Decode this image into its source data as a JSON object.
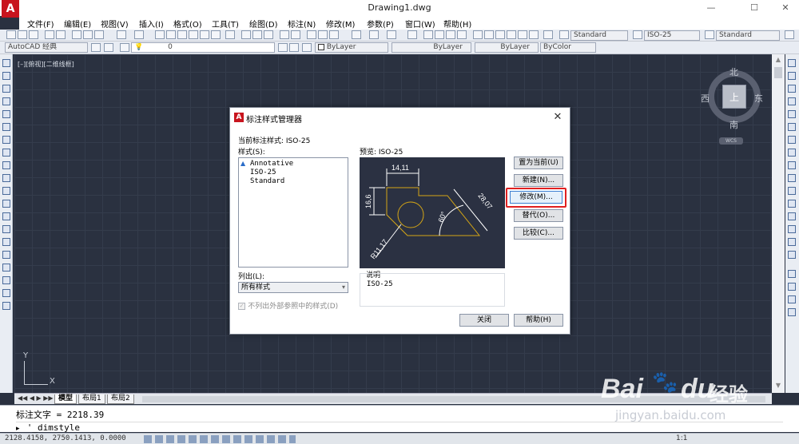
{
  "window": {
    "title": "Drawing1.dwg",
    "logo_letter": "A",
    "controls": [
      "—",
      "☐",
      "✕"
    ]
  },
  "menu": [
    "文件(F)",
    "编辑(E)",
    "视图(V)",
    "插入(I)",
    "格式(O)",
    "工具(T)",
    "绘图(D)",
    "标注(N)",
    "修改(M)",
    "参数(P)",
    "窗口(W)",
    "帮助(H)"
  ],
  "toolbar1": {
    "text_style": "Standard",
    "dim_style": "ISO-25",
    "table_style": "Standard"
  },
  "toolbar2": {
    "workspace": "AutoCAD 经典",
    "layer": "0",
    "color": "ByLayer",
    "linetype": "ByLayer",
    "lineweight": "ByLayer",
    "plotstyle": "ByColor"
  },
  "canvas": {
    "view_label": "[–][俯视][二维线框]"
  },
  "viewcube": {
    "north": "北",
    "south": "南",
    "east": "东",
    "west": "西",
    "face": "上",
    "wcs": "WCS"
  },
  "ucs": {
    "y": "Y",
    "x": "X"
  },
  "tabs": [
    "模型",
    "布局1",
    "布局2"
  ],
  "command": {
    "history": "标注文字 = 2218.39",
    "prompt_icon": "▸",
    "input": "'_dimstyle"
  },
  "status": {
    "coords": "2128.4158, 2750.1413, 0.0000",
    "scale": "1:1"
  },
  "dialog": {
    "title": "标注样式管理器",
    "current_label": "当前标注样式: ISO-25",
    "styles_label": "样式(S):",
    "styles": [
      "Annotative",
      "ISO-25",
      "Standard"
    ],
    "preview_label": "预览: ISO-25",
    "list_label": "列出(L):",
    "list_value": "所有样式",
    "checkbox_label": "不列出外部参照中的样式(D)",
    "description_label": "说明",
    "description_value": "ISO-25",
    "buttons": {
      "set_current": "置为当前(U)",
      "new": "新建(N)...",
      "modify": "修改(M)...",
      "override": "替代(O)...",
      "compare": "比较(C)...",
      "close": "关闭",
      "help": "帮助(H)"
    },
    "preview_dims": {
      "top": "14,11",
      "left": "16,6",
      "slant": "28,07",
      "angle": "60°",
      "radius": "R11,17"
    }
  },
  "watermark": {
    "brand": "Bai",
    "brand2": "du",
    "product": "经验",
    "url": "jingyan.baidu.com"
  }
}
